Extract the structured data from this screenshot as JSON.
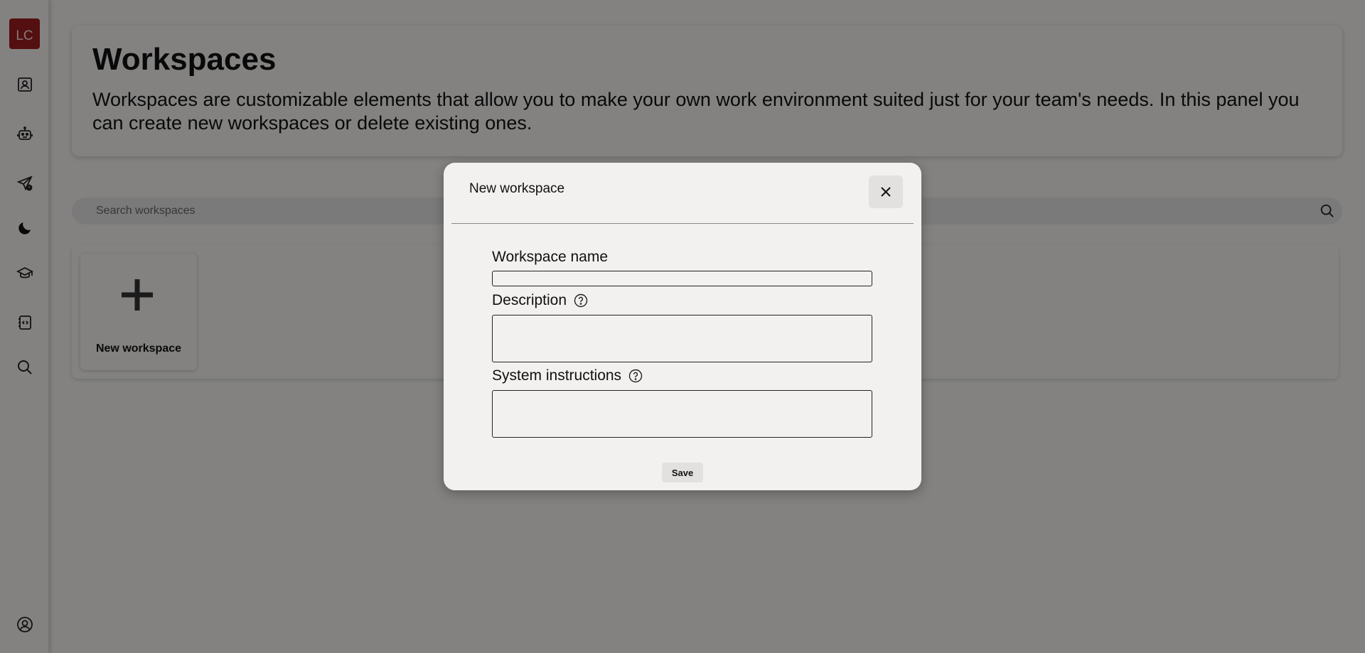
{
  "sidebar": {
    "logo_text": "LC",
    "items": [
      {
        "icon": "contact-card-icon"
      },
      {
        "icon": "robot-icon"
      },
      {
        "icon": "send-alert-icon"
      },
      {
        "icon": "moon-icon"
      },
      {
        "icon": "graduation-cap-icon"
      },
      {
        "icon": "code-document-icon"
      },
      {
        "icon": "search-icon"
      },
      {
        "icon": "user-account-icon"
      }
    ]
  },
  "header": {
    "title": "Workspaces",
    "description": "Workspaces are customizable elements that allow you to make your own work environment suited just for your team's needs. In this panel you can create new workspaces or delete existing ones."
  },
  "search": {
    "placeholder": "Search workspaces"
  },
  "workspaces": {
    "new_label": "New workspace"
  },
  "modal": {
    "title": "New workspace",
    "fields": {
      "name_label": "Workspace name",
      "name_value": "",
      "description_label": "Description",
      "description_value": "",
      "system_label": "System instructions",
      "system_value": ""
    },
    "save_label": "Save"
  },
  "colors": {
    "brand": "#9b1c1f",
    "background": "#f2f1ef",
    "overlay": "rgba(0,0,0,0.46)"
  }
}
